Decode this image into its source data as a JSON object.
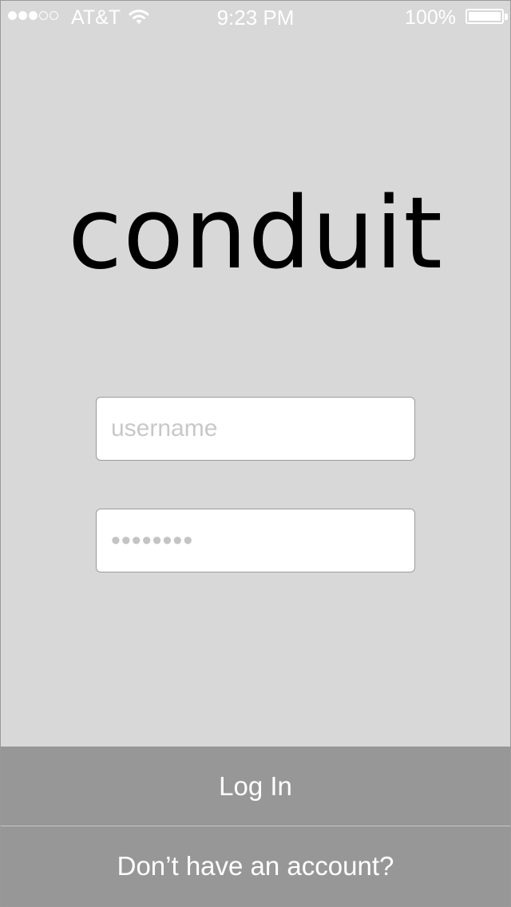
{
  "status_bar": {
    "signal_bars_filled": 3,
    "signal_bars_total": 5,
    "carrier": "AT&T",
    "time": "9:23 PM",
    "battery_percent": "100%",
    "battery_level": 1.0
  },
  "logo": {
    "text": "conduit"
  },
  "form": {
    "username_placeholder": "username",
    "username_value": "",
    "password_value": "••••••••"
  },
  "actions": {
    "login_label": "Log In",
    "signup_label": "Don’t have an account?"
  },
  "colors": {
    "background": "#d8d8d8",
    "button_background": "#979797",
    "button_text": "#ffffff",
    "placeholder_text": "#c8c8c8"
  }
}
